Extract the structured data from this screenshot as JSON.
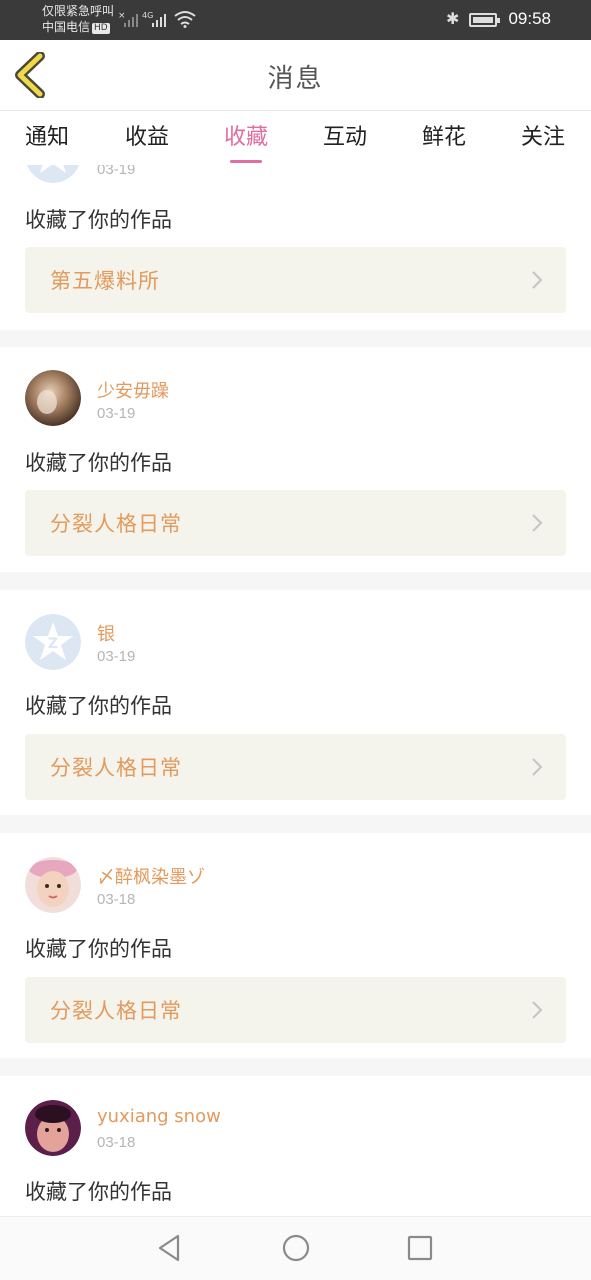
{
  "statusbar": {
    "carrier_line1": "仅限紧急呼叫",
    "carrier_line2": "中国电信",
    "hd_badge": "HD",
    "network": "4G",
    "time": "09:58",
    "icons": [
      "signal-icon",
      "wifi-icon",
      "bluetooth-icon",
      "battery-icon"
    ]
  },
  "header": {
    "title": "消息",
    "back_icon": "back-chevron-icon",
    "back_color": "#f1d94a"
  },
  "tabs": [
    {
      "label": "通知",
      "active": false
    },
    {
      "label": "收益",
      "active": false
    },
    {
      "label": "收藏",
      "active": true
    },
    {
      "label": "互动",
      "active": false
    },
    {
      "label": "鲜花",
      "active": false
    },
    {
      "label": "关注",
      "active": false
    }
  ],
  "accent_color": "#e06ea2",
  "name_color": "#e39a5c",
  "feed": [
    {
      "user": "",
      "date": "03-19",
      "action": "收藏了你的作品",
      "work": "第五爆料所",
      "avatar": "default-avatar-icon"
    },
    {
      "user": "少安毋躁",
      "date": "03-19",
      "action": "收藏了你的作品",
      "work": "分裂人格日常",
      "avatar": "user-photo"
    },
    {
      "user": "银",
      "date": "03-19",
      "action": "收藏了你的作品",
      "work": "分裂人格日常",
      "avatar": "default-avatar-icon"
    },
    {
      "user": "〆醉枫染墨ゾ",
      "date": "03-18",
      "action": "收藏了你的作品",
      "work": "分裂人格日常",
      "avatar": "user-photo"
    },
    {
      "user": "yuxiang snow",
      "date": "03-18",
      "action": "收藏了你的作品",
      "work": "",
      "avatar": "user-photo"
    }
  ],
  "navbar": {
    "icons": [
      "back-triangle-icon",
      "home-circle-icon",
      "recents-square-icon"
    ]
  }
}
